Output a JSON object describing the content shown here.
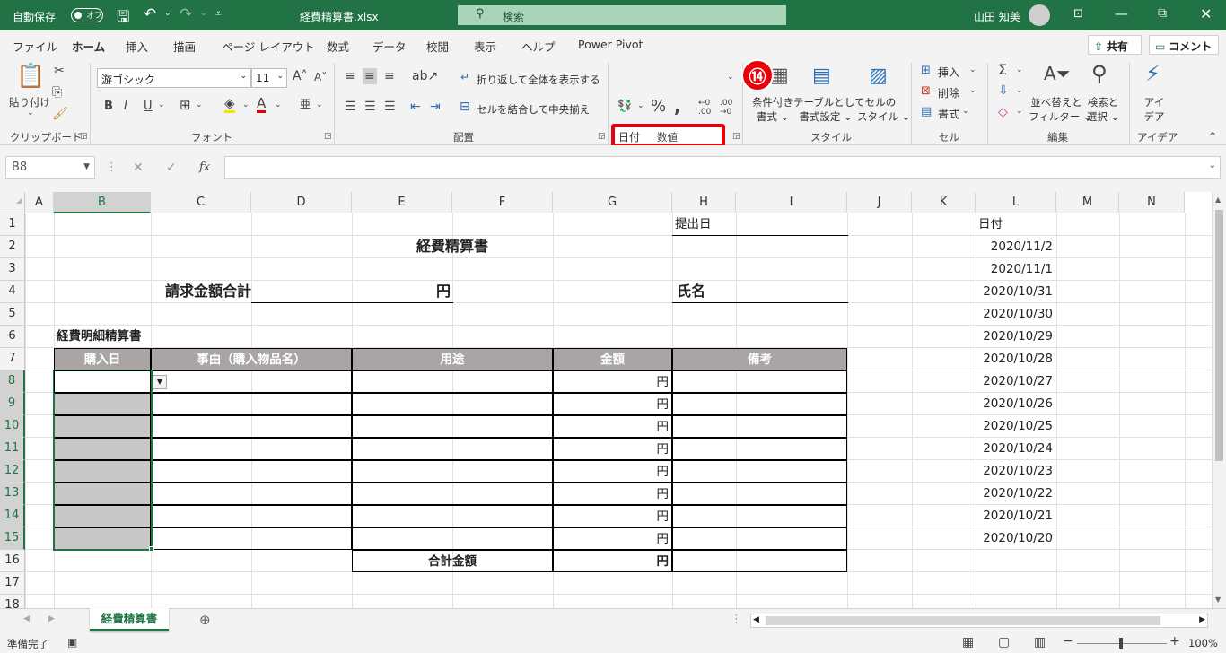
{
  "titlebar": {
    "autosave_label": "自動保存",
    "autosave_state": "オフ",
    "filename": "経費精算書.xlsx",
    "search_placeholder": "検索",
    "user_name": "山田 知美"
  },
  "menu": {
    "tabs": [
      "ファイル",
      "ホーム",
      "挿入",
      "描画",
      "ページ レイアウト",
      "数式",
      "データ",
      "校閲",
      "表示",
      "ヘルプ",
      "Power Pivot"
    ],
    "share": "共有",
    "comment": "コメント"
  },
  "ribbon": {
    "clipboard": {
      "paste": "貼り付け",
      "label": "クリップボード"
    },
    "font": {
      "name": "游ゴシック",
      "size": "11",
      "label": "フォント"
    },
    "alignment": {
      "wrap": "折り返して全体を表示する",
      "merge": "セルを結合して中央揃え",
      "label": "配置"
    },
    "number": {
      "format": "日付",
      "label": "数値"
    },
    "styles": {
      "conditional": [
        "条件付き",
        "書式"
      ],
      "table": [
        "テーブルとして",
        "書式設定"
      ],
      "cellstyle": [
        "セルの",
        "スタイル"
      ],
      "label": "スタイル"
    },
    "cells": {
      "insert": "挿入",
      "delete": "削除",
      "format": "書式",
      "label": "セル"
    },
    "editing": {
      "sort": [
        "並べ替えと",
        "フィルター"
      ],
      "find": [
        "検索と",
        "選択"
      ],
      "label": "編集"
    },
    "ideas": {
      "btn": [
        "アイ",
        "デア"
      ],
      "label": "アイデア"
    }
  },
  "step_badge": "⑭",
  "formula": {
    "namebox": "B8",
    "fx": "fx",
    "value": ""
  },
  "sheet": {
    "columns": [
      "A",
      "B",
      "C",
      "D",
      "E",
      "F",
      "G",
      "H",
      "I",
      "J",
      "K",
      "L",
      "M",
      "N"
    ],
    "selected_col": "B",
    "selected_rows": [
      8,
      9,
      10,
      11,
      12,
      13,
      14,
      15
    ],
    "rows": [
      1,
      2,
      3,
      4,
      5,
      6,
      7,
      8,
      9,
      10,
      11,
      12,
      13,
      14,
      15,
      16,
      17,
      18
    ],
    "title": "経費精算書",
    "submit_date_label": "提出日",
    "total_label": "請求金額合計",
    "yen": "円",
    "name_label": "氏名",
    "detail_label": "経費明細精算書",
    "headers": [
      "購入日",
      "事由（購入物品名）",
      "用途",
      "金額",
      "備考"
    ],
    "total_row_label": "合計金額",
    "l_header": "日付",
    "l_dates": [
      "2020/11/2",
      "2020/11/1",
      "2020/10/31",
      "2020/10/30",
      "2020/10/29",
      "2020/10/28",
      "2020/10/27",
      "2020/10/26",
      "2020/10/25",
      "2020/10/24",
      "2020/10/23",
      "2020/10/22",
      "2020/10/21",
      "2020/10/20"
    ]
  },
  "sheettabs": {
    "active": "経費精算書"
  },
  "status": {
    "ready": "準備完了",
    "zoom": "100%"
  }
}
